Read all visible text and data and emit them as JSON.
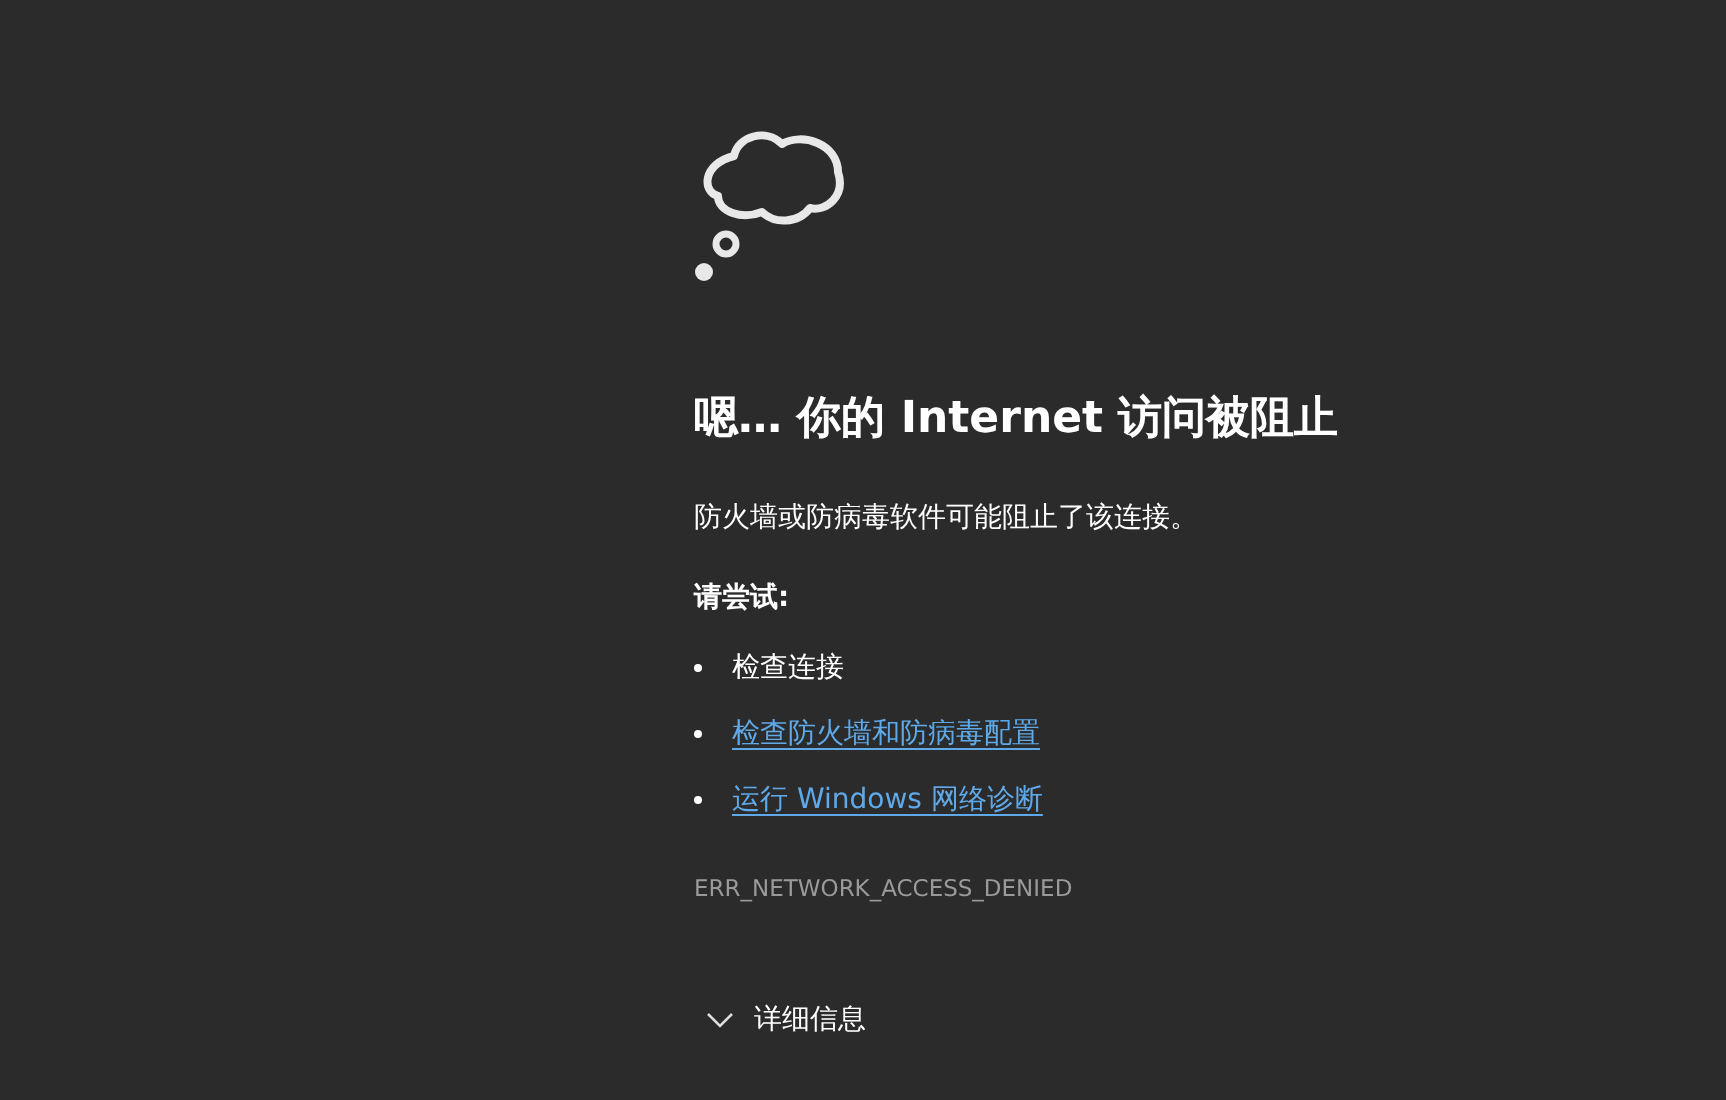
{
  "title": "嗯… 你的 Internet 访问被阻止",
  "message": "防火墙或防病毒软件可能阻止了该连接。",
  "suggestions_heading": "请尝试:",
  "suggestions": [
    {
      "kind": "text",
      "label": "检查连接"
    },
    {
      "kind": "link",
      "label": "检查防火墙和防病毒配置"
    },
    {
      "kind": "link",
      "label": "运行 Windows 网络诊断"
    }
  ],
  "error_code": "ERR_NETWORK_ACCESS_DENIED",
  "details": {
    "label": "详细信息",
    "expanded": false
  }
}
